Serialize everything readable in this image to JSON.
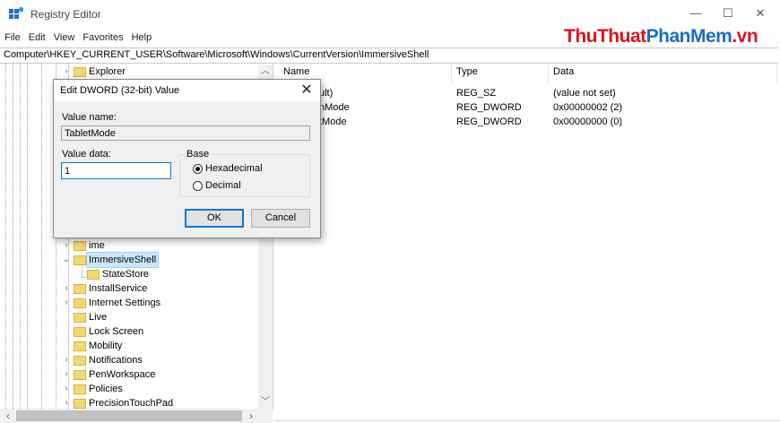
{
  "window": {
    "title": "Registry Editor",
    "minimize_glyph": "—",
    "maximize_glyph": "☐",
    "close_glyph": "✕"
  },
  "menu": [
    "File",
    "Edit",
    "View",
    "Favorites",
    "Help"
  ],
  "watermark": {
    "part1": "ThuThuat",
    "part2": "PhanMem",
    "part3": ".vn"
  },
  "address": "Computer\\HKEY_CURRENT_USER\\Software\\Microsoft\\Windows\\CurrentVersion\\ImmersiveShell",
  "tree": {
    "items": [
      {
        "label": "Explorer",
        "expander": ">"
      },
      {
        "label": "ime",
        "expander": ">"
      },
      {
        "label": "ImmersiveShell",
        "expander": "v",
        "selected": true
      },
      {
        "label": "StateStore",
        "expander": ""
      },
      {
        "label": "InstallService",
        "expander": ">"
      },
      {
        "label": "Internet Settings",
        "expander": ">"
      },
      {
        "label": "Live",
        "expander": ""
      },
      {
        "label": "Lock Screen",
        "expander": ""
      },
      {
        "label": "Mobility",
        "expander": ""
      },
      {
        "label": "Notifications",
        "expander": ">"
      },
      {
        "label": "PenWorkspace",
        "expander": ">"
      },
      {
        "label": "Policies",
        "expander": ">"
      },
      {
        "label": "PrecisionTouchPad",
        "expander": ">"
      }
    ]
  },
  "list": {
    "columns": [
      "Name",
      "Type",
      "Data"
    ],
    "rows": [
      {
        "name": "ult)",
        "type": "REG_SZ",
        "data": "(value not set)"
      },
      {
        "name": "nMode",
        "type": "REG_DWORD",
        "data": "0x00000002 (2)"
      },
      {
        "name": "tMode",
        "type": "REG_DWORD",
        "data": "0x00000000 (0)"
      }
    ]
  },
  "dialog": {
    "title": "Edit DWORD (32-bit) Value",
    "close_glyph": "✕",
    "value_name_label": "Value name:",
    "value_name": "TabletMode",
    "value_data_label": "Value data:",
    "value_data": "1",
    "base_label": "Base",
    "base_options": [
      {
        "label": "Hexadecimal",
        "selected": true
      },
      {
        "label": "Decimal",
        "selected": false
      }
    ],
    "ok_label": "OK",
    "cancel_label": "Cancel"
  },
  "icons": {
    "app": "registry-editor-icon",
    "folder": "folder-icon",
    "scroll_up": "chevron-up-icon",
    "scroll_down": "chevron-down-icon",
    "scroll_left": "chevron-left-icon",
    "scroll_right": "chevron-right-icon"
  },
  "colors": {
    "selection": "#cce8ff",
    "folder": "#f6d872",
    "accent": "#0078d7",
    "watermark_red": "#d8161d",
    "watermark_blue": "#1c6cc4"
  }
}
